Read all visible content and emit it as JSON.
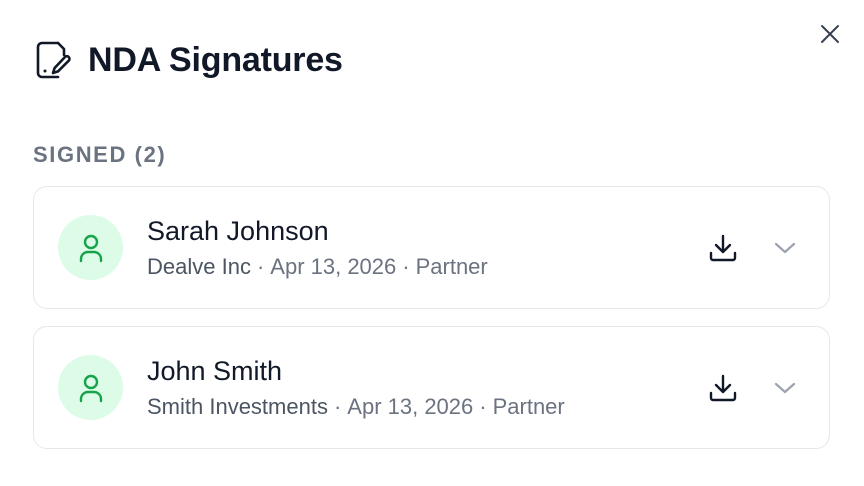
{
  "dialog": {
    "title": "NDA Signatures",
    "title_icon": "file-signature-icon",
    "close_icon": "close-icon"
  },
  "signed_section": {
    "label": "SIGNED (2)",
    "items": [
      {
        "name": "Sarah Johnson",
        "company": "Dealve Inc",
        "date": "Apr 13, 2026",
        "role": "Partner",
        "separator": "·",
        "avatar_icon": "user-icon",
        "download_icon": "download-icon",
        "expand_icon": "chevron-down-icon"
      },
      {
        "name": "John Smith",
        "company": "Smith Investments",
        "date": "Apr 13, 2026",
        "role": "Partner",
        "separator": "·",
        "avatar_icon": "user-icon",
        "download_icon": "download-icon",
        "expand_icon": "chevron-down-icon"
      }
    ]
  },
  "colors": {
    "avatar_bg": "#dcfce7",
    "avatar_icon": "#16a34a",
    "muted_text": "#6b7280",
    "border": "#e5e7eb"
  }
}
